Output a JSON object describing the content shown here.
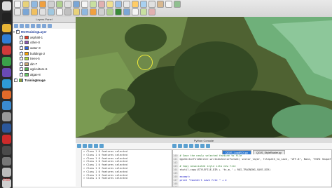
{
  "dock": {
    "icons": [
      "finder-icon",
      "terminal-icon",
      "chrome-icon",
      "app-icon",
      "app-icon",
      "app-icon",
      "app-icon",
      "app-icon",
      "app-icon",
      "app-icon",
      "app-icon",
      "word-icon",
      "app-icon",
      "app-icon",
      "app-icon",
      "trash-icon",
      "power-icon"
    ],
    "clock": "2:56"
  },
  "layers_panel": {
    "title": "Layers Panel",
    "group_name": "ROITrainingLayer",
    "classes": [
      {
        "label": "asphalt-1",
        "color": "#e83b2a"
      },
      {
        "label": "other-0",
        "color": "#8e5ab5"
      },
      {
        "label": "water-3",
        "color": "#3366dd"
      },
      {
        "label": "buildings-2",
        "color": "#ffa500"
      },
      {
        "label": "trees-5",
        "color": "#aadd44"
      },
      {
        "label": "dirt-7",
        "color": "#c4a574"
      },
      {
        "label": "agriculture-6",
        "color": "#4fb04f"
      },
      {
        "label": "algae-8",
        "color": "#66cc66"
      }
    ],
    "raster_name": "TrainingImage"
  },
  "console": {
    "title": "Python Console",
    "output_lines": [
      "> Class  1 0 features selected",
      "> Class  1 0 features selected",
      "> Class  1 0 features selected",
      "> Class  1 0 features selected",
      "> Class  1 0 features selected",
      "> Class  1 0 features selected",
      "> Class  1 0 features selected",
      "> Class  1 0 features selected",
      "> Class  1 0 features selected"
    ],
    "tabs": [
      "QGIS_LoadROI.py",
      "QGIS_StyleRaster.py"
    ],
    "active_tab": 0,
    "line_numbers": [
      "140",
      "141",
      "142",
      "143",
      "144",
      "145",
      "146",
      "147",
      "148",
      "149"
    ],
    "code_lines": [
      "# Save the newly selected feature to file",
      "QgsVectorFileWriter.writeAsVectorFormat( vector_layer, filepath_to_save, \"UTF-8\", None, \"ESRI Shapefile\")",
      "",
      "# Copy associated style into new file",
      "shutil.copy(STYLEFILE_DIR + 'ts_m_' + ROI_TRAINING_SAVE_DIR)",
      "",
      "except:",
      "    print \"Couldn't save file \" + e",
      "",
      ""
    ]
  }
}
